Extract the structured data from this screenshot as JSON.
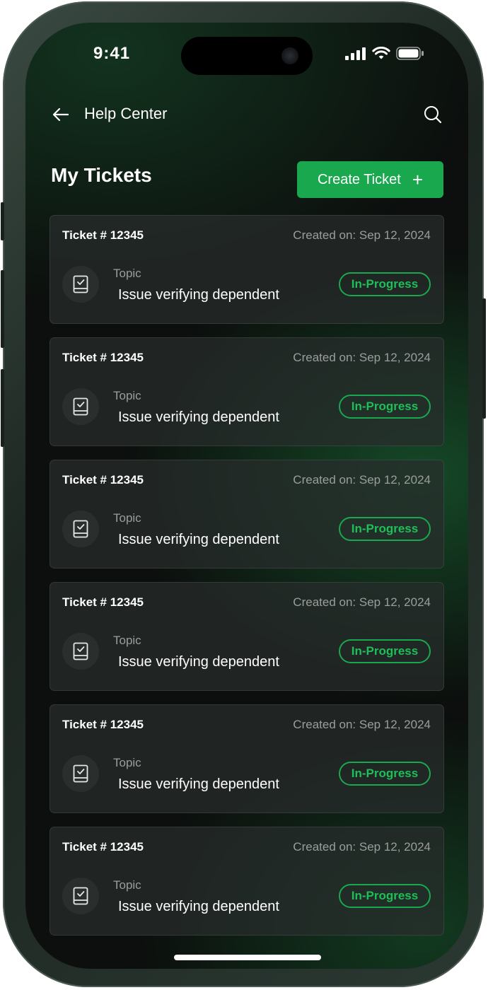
{
  "status_bar": {
    "time": "9:41"
  },
  "header": {
    "title": "Help Center",
    "back_icon": "arrow-left-icon",
    "search_icon": "search-icon"
  },
  "page": {
    "title": "My Tickets",
    "create_button_label": "Create Ticket",
    "create_button_icon": "+"
  },
  "colors": {
    "accent": "#1aa84f",
    "background": "#0c0f0d",
    "card": "#282c2c"
  },
  "tickets": [
    {
      "id": "Ticket # 12345",
      "created": "Created on: Sep 12, 2024",
      "topic_label": "Topic",
      "topic": "Issue verifying dependent",
      "status": "In-Progress"
    },
    {
      "id": "Ticket # 12345",
      "created": "Created on: Sep 12, 2024",
      "topic_label": "Topic",
      "topic": "Issue verifying dependent",
      "status": "In-Progress"
    },
    {
      "id": "Ticket # 12345",
      "created": "Created on: Sep 12, 2024",
      "topic_label": "Topic",
      "topic": "Issue verifying dependent",
      "status": "In-Progress"
    },
    {
      "id": "Ticket # 12345",
      "created": "Created on: Sep 12, 2024",
      "topic_label": "Topic",
      "topic": "Issue verifying dependent",
      "status": "In-Progress"
    },
    {
      "id": "Ticket # 12345",
      "created": "Created on: Sep 12, 2024",
      "topic_label": "Topic",
      "topic": "Issue verifying dependent",
      "status": "In-Progress"
    },
    {
      "id": "Ticket # 12345",
      "created": "Created on: Sep 12, 2024",
      "topic_label": "Topic",
      "topic": "Issue verifying dependent",
      "status": "In-Progress"
    }
  ]
}
